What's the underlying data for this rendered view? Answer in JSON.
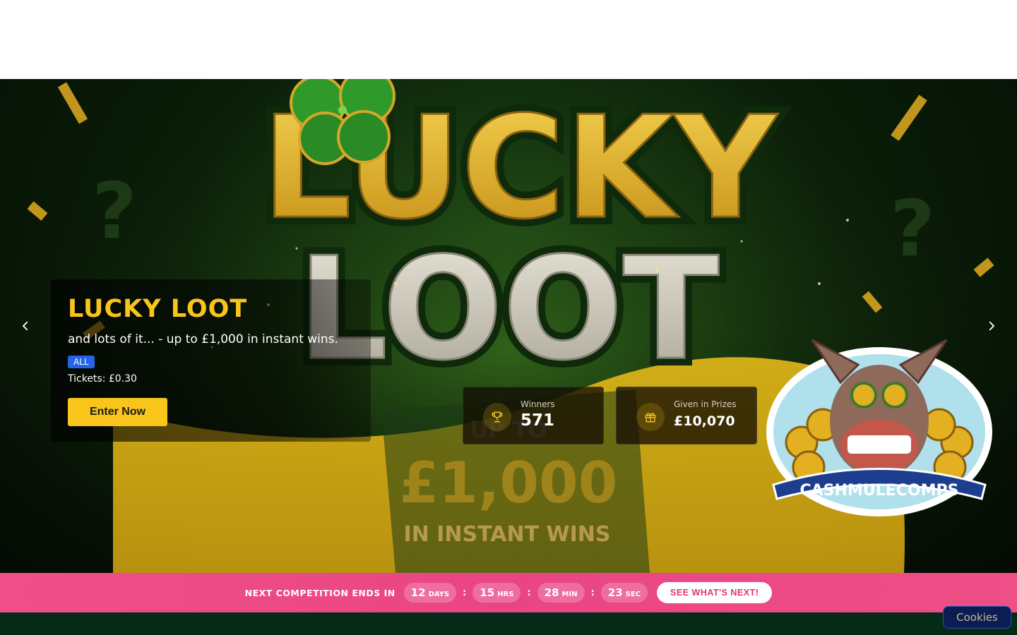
{
  "hero": {
    "headline_art_line1": "LUCKY",
    "headline_art_line2": "LOOT",
    "art_up_to": "UP TO",
    "art_amount": "£1,000",
    "art_instant": "IN INSTANT WINS",
    "logo_text": "CASHMULECOMPS",
    "prev_icon": "chevron-left-icon",
    "next_icon": "chevron-right-icon"
  },
  "competition": {
    "title": "LUCKY LOOT",
    "subtitle": "and lots of it... - up to £1,000 in instant wins.",
    "badge": "ALL",
    "tickets": "Tickets: £0.30",
    "cta": "Enter Now"
  },
  "stats": [
    {
      "label": "Winners",
      "value": "571",
      "icon": "trophy-icon"
    },
    {
      "label": "Given in Prizes",
      "value": "£10,070",
      "icon": "gift-icon"
    }
  ],
  "countdown": {
    "label": "NEXT COMPETITION ENDS IN",
    "days": "12",
    "days_unit": "DAYS",
    "hrs": "15",
    "hrs_unit": "HRS",
    "min": "28",
    "min_unit": "MIN",
    "sec": "23",
    "sec_unit": "SEC",
    "separator": ":",
    "button": "SEE WHAT'S NEXT!"
  },
  "cookies": {
    "label": "Cookies"
  },
  "colors": {
    "accent_yellow": "#f9c51b",
    "badge_blue": "#2563eb",
    "countdown_pink": "#ec4a86",
    "footer_green": "#052a17"
  }
}
